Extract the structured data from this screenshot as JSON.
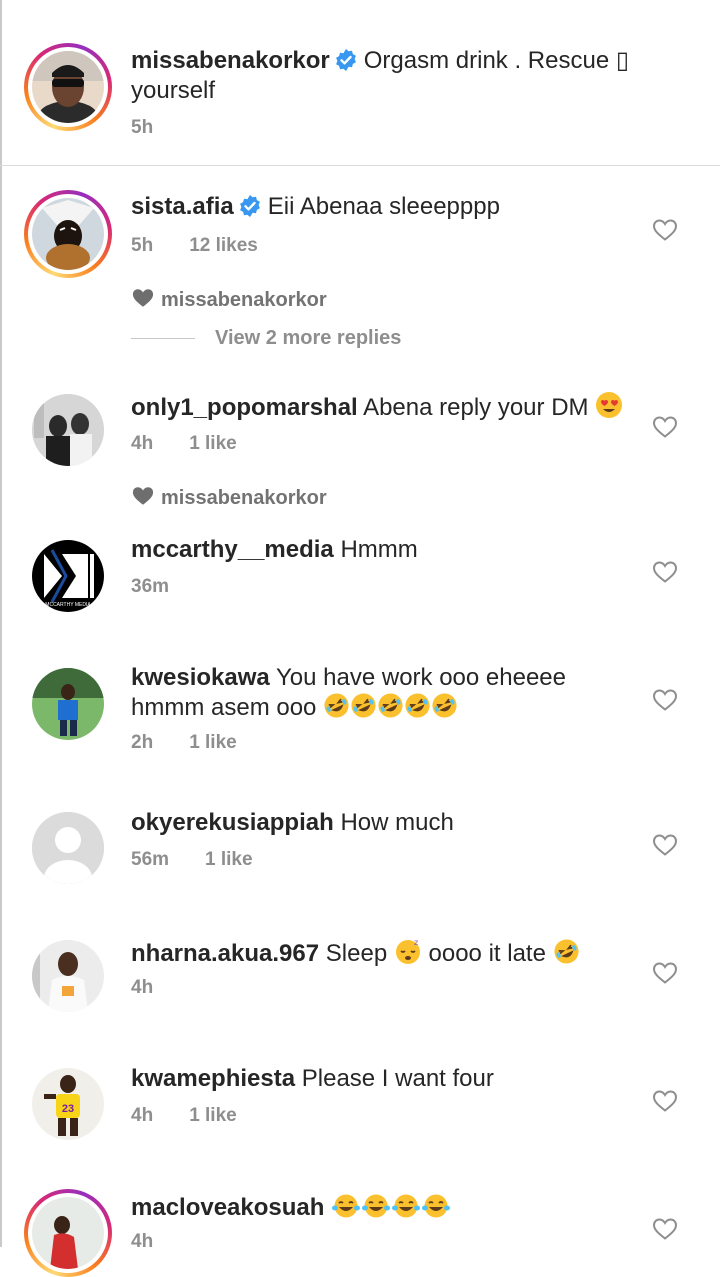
{
  "caption": {
    "username": "missabenakorkor",
    "text": "Orgasm drink . Rescue",
    "glyph": "▯",
    "text2": "yourself",
    "time": "5h"
  },
  "comments": [
    {
      "username": "sista.afia",
      "verified": true,
      "text": "Eii Abenaa sleeepppp",
      "time": "5h",
      "likes": "12 likes",
      "liked_by": "missabenakorkor",
      "view_replies": "View 2 more replies"
    },
    {
      "username": "only1_popomarshal",
      "text": "Abena reply your DM",
      "emoji": "heart-eyes",
      "time": "4h",
      "likes": "1 like",
      "liked_by": "missabenakorkor"
    },
    {
      "username": "mccarthy__media",
      "text": "Hmmm",
      "time": "36m",
      "avatar_text": "MCCARTHY MEDIA"
    },
    {
      "username": "kwesiokawa",
      "text": "You have work ooo eheeee hmmm asem ooo",
      "emoji": "rofl x5",
      "time": "2h",
      "likes": "1 like"
    },
    {
      "username": "okyerekusiappiah",
      "text": "How much",
      "time": "56m",
      "likes": "1 like"
    },
    {
      "username": "nharna.akua.967",
      "text_a": "Sleep",
      "text_b": "oooo it late",
      "emoji": "sleepy, rofl",
      "time": "4h"
    },
    {
      "username": "kwamephiesta",
      "text": "Please I want four",
      "time": "4h",
      "likes": "1 like",
      "avatar_text": "23"
    },
    {
      "username": "macloveakosuah",
      "text": "",
      "emoji": "joy x4",
      "time": "4h"
    }
  ],
  "colors": {
    "username": "#262626",
    "secondary": "#8e8e8e",
    "verified": "#3897f0",
    "divider": "#dbdbdb"
  }
}
